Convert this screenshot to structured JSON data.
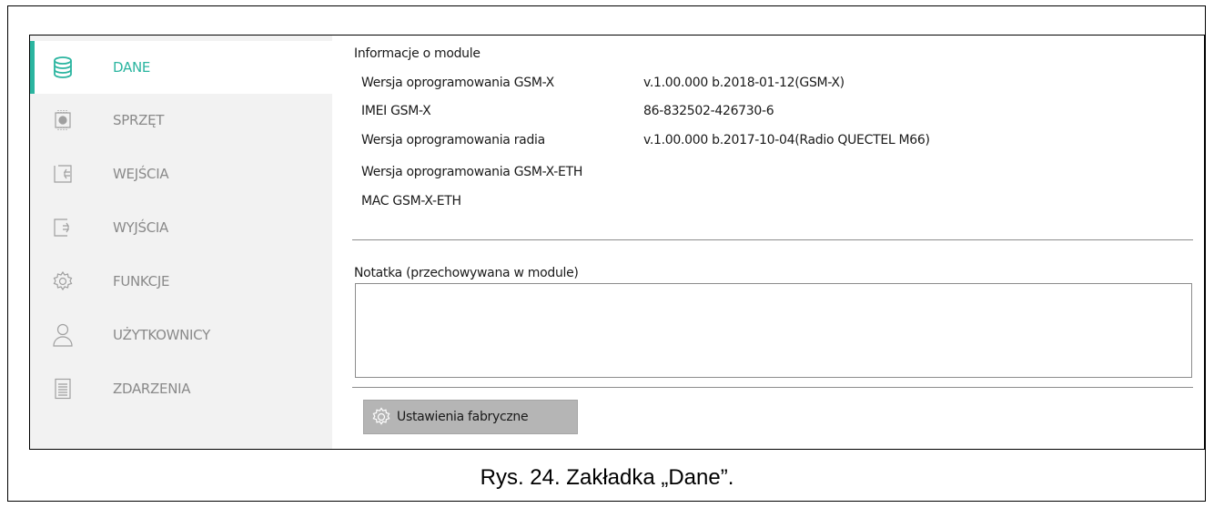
{
  "sidebar": {
    "items": [
      {
        "label": "DANE",
        "icon": "database-icon",
        "active": true
      },
      {
        "label": "SPRZĘT",
        "icon": "chip-icon",
        "active": false
      },
      {
        "label": "WEJŚCIA",
        "icon": "input-icon",
        "active": false
      },
      {
        "label": "WYJŚCIA",
        "icon": "output-icon",
        "active": false
      },
      {
        "label": "FUNKCJE",
        "icon": "gear-icon",
        "active": false
      },
      {
        "label": "UŻYTKOWNICY",
        "icon": "user-icon",
        "active": false
      },
      {
        "label": "ZDARZENIA",
        "icon": "event-log-icon",
        "active": false
      }
    ]
  },
  "module_info": {
    "title": "Informacje o module",
    "rows": [
      {
        "label": "Wersja oprogramowania GSM-X",
        "value": "v.1.00.000 b.2018-01-12(GSM-X)"
      },
      {
        "label": "IMEI GSM-X",
        "value": "86-832502-426730-6"
      },
      {
        "label": "Wersja oprogramowania radia",
        "value": "v.1.00.000 b.2017-10-04(Radio QUECTEL M66)"
      },
      {
        "label": "Wersja oprogramowania GSM-X-ETH",
        "value": ""
      },
      {
        "label": "MAC GSM-X-ETH",
        "value": ""
      }
    ]
  },
  "note": {
    "label": "Notatka (przechowywana w module)",
    "value": ""
  },
  "factory_button": {
    "label": "Ustawienia fabryczne",
    "icon": "factory-reset-icon"
  },
  "caption": "Rys. 24. Zakładka „Dane”.",
  "colors": {
    "accent": "#2bb5a0",
    "sidebar_bg": "#f2f2f2",
    "inactive_text": "#8a8a8a",
    "button_bg": "#b5b5b5"
  }
}
